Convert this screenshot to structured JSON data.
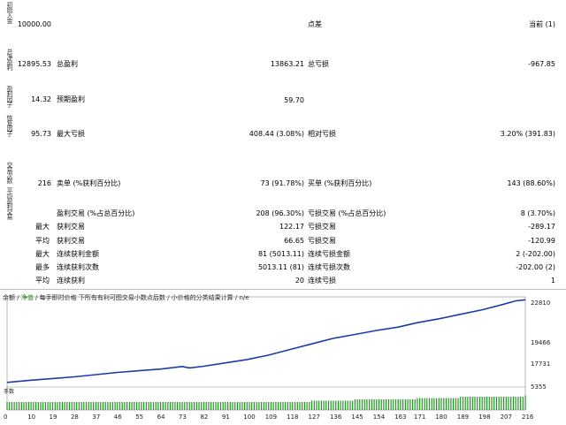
{
  "left_vertical_labels": [
    "初始入金",
    "总净盈利",
    "盈利因子",
    "恢复因子",
    "交易次数",
    "平均盈利交易"
  ],
  "rows": [
    {
      "c1": "10000.00",
      "c2": "",
      "c3": "",
      "c4": "点差",
      "c5": "当前 (1)"
    },
    {
      "c1": "12895.53",
      "c2": "总盈利",
      "c3": "13863.21",
      "c4": "总亏损",
      "c5": "-967.85"
    },
    {
      "c1": "14.32",
      "c2": "预期盈利",
      "c3": "59.70",
      "c4": "",
      "c5": ""
    },
    {
      "c1": "95.73",
      "c2": "最大亏损",
      "c3": "408.44 (3.08%)",
      "c4": "相对亏损",
      "c5": "3.20% (391.83)"
    },
    {
      "c1": "216",
      "c2": "卖单 (%获利百分比)",
      "c3": "73 (91.78%)",
      "c4": "买单 (%获利百分比)",
      "c5": "143 (88.60%)"
    }
  ],
  "stats_rows": [
    {
      "l1": "",
      "l2": "盈利交易 (%占总百分比)",
      "v1": "208 (96.30%)",
      "l3": "亏损交易 (%占总百分比)",
      "v2": "8 (3.70%)"
    },
    {
      "l1": "最大",
      "l2": "获利交易",
      "v1": "122.17",
      "l3": "亏损交易",
      "v2": "-289.17"
    },
    {
      "l1": "平均",
      "l2": "获利交易",
      "v1": "66.65",
      "l3": "亏损交易",
      "v2": "-120.99"
    },
    {
      "l1": "最大",
      "l2": "连续获利金额",
      "v1": "81 (5013.11)",
      "l3": "连续亏损金额",
      "v2": "2 (-202.00)"
    },
    {
      "l1": "最多",
      "l2": "连续获利次数",
      "v1": "5013.11 (81)",
      "l3": "连续亏损次数",
      "v2": "-202.00 (2)"
    },
    {
      "l1": "平均",
      "l2": "连续获利",
      "v1": "20",
      "l3": "连续亏损",
      "v2": "1"
    }
  ],
  "chart": {
    "caption_prefix": "余额",
    "caption_sep": " / ",
    "caption_equity": "净值",
    "caption_rest": " / 每手即时价格 下所有有利可图交易小数点后数 / 小价格的分类结果计算 / n/e",
    "y_labels": [
      "22810",
      "19466",
      "17731",
      "5355"
    ],
    "volume_label": "手数",
    "x_labels": [
      "0",
      "10",
      "19",
      "28",
      "37",
      "46",
      "55",
      "64",
      "73",
      "82",
      "91",
      "100",
      "109",
      "118",
      "127",
      "136",
      "145",
      "154",
      "163",
      "171",
      "180",
      "189",
      "198",
      "207",
      "216"
    ],
    "line_color": "#1a3caa",
    "volume_color": "#1a9a1a"
  },
  "chart_data": {
    "type": "line",
    "x": [
      0,
      10,
      19,
      28,
      37,
      46,
      55,
      64,
      73,
      76,
      82,
      91,
      100,
      109,
      118,
      127,
      136,
      145,
      154,
      163,
      171,
      180,
      189,
      198,
      207,
      212,
      216
    ],
    "series": [
      {
        "values": [
          10000,
          10400,
          10700,
          11000,
          11400,
          11800,
          12100,
          12400,
          12850,
          12600,
          12900,
          13500,
          14100,
          14900,
          15900,
          16900,
          17900,
          18600,
          19300,
          19900,
          20700,
          21400,
          22200,
          23000,
          24000,
          24600,
          24800
        ]
      }
    ],
    "ylim": [
      5355,
      22810
    ],
    "volume_x": [
      0,
      10,
      19,
      28,
      37,
      46,
      55,
      64,
      73,
      82,
      91,
      100,
      109,
      118,
      127,
      136,
      145,
      154,
      163,
      171,
      180,
      189,
      198,
      207,
      216
    ],
    "volume_values": [
      0.3,
      0.3,
      0.3,
      0.3,
      0.3,
      0.3,
      0.3,
      0.3,
      0.3,
      0.3,
      0.3,
      0.3,
      0.3,
      0.3,
      0.35,
      0.35,
      0.4,
      0.4,
      0.4,
      0.45,
      0.45,
      0.5,
      0.5,
      0.5,
      0.55
    ]
  }
}
